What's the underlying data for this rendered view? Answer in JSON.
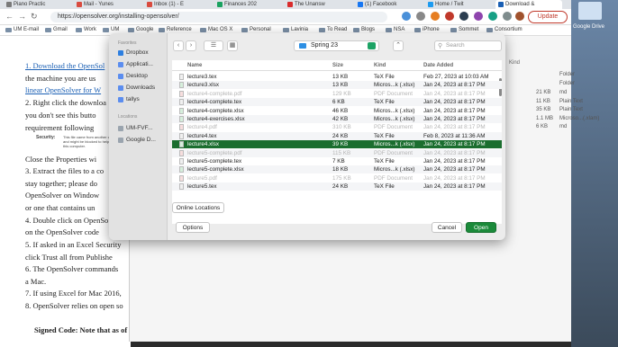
{
  "browser": {
    "tabs": [
      {
        "label": "Piano Practic",
        "color": "#7a7a7a"
      },
      {
        "label": "Mail - Yunes",
        "color": "#d94b3f"
      },
      {
        "label": "Inbox (1) - E",
        "color": "#d94b3f"
      },
      {
        "label": "Finances 202",
        "color": "#1aa260"
      },
      {
        "label": "The Unansw",
        "color": "#d92c2c"
      },
      {
        "label": "(1) Facebook",
        "color": "#1877f2"
      },
      {
        "label": "Home / Twit",
        "color": "#1d9bf0"
      },
      {
        "label": "Download &",
        "color": "#1a5fb4"
      }
    ],
    "url": "https://opensolver.org/installing-opensolver/",
    "update_label": "Update",
    "bookmarks": [
      "UM E-mail",
      "Gmail",
      "Work",
      "UM",
      "Google",
      "Reference",
      "Mac OS X",
      "Personal",
      "Lavinia",
      "To Read",
      "Blogs",
      "NSA",
      "iPhone",
      "Sommet",
      "Consortium"
    ]
  },
  "desktop": {
    "google_drive_label": "Google Drive"
  },
  "page": {
    "lines": [
      {
        "text": "1. Download the OpenSol",
        "style": "link"
      },
      {
        "text": "   the machine you are us",
        "style": "normal"
      },
      {
        "text": "   linear OpenSolver for W",
        "style": "link"
      },
      {
        "text": "2. Right click the downloa",
        "style": "normal"
      },
      {
        "text": "   you don't see this butto",
        "style": "normal"
      },
      {
        "text": "   requirement following",
        "style": "normal"
      },
      {
        "text": "   Close the Properties wi",
        "style": "normal"
      },
      {
        "text": "3. Extract the files to a co",
        "style": "normal"
      },
      {
        "text": "   stay together; please do",
        "style": "normal"
      },
      {
        "text": "   OpenSolver on Window",
        "style": "normal"
      },
      {
        "text": "   or one that contains un",
        "style": "normal"
      },
      {
        "text": "4. Double click on OpenSo",
        "style": "normal"
      },
      {
        "text": "   on the OpenSolver code",
        "style": "normal"
      },
      {
        "text": "5. If asked in an Excel Security",
        "style": "normal"
      },
      {
        "text": "   click Trust all from Publishe",
        "style": "normal"
      },
      {
        "text": "6. The OpenSolver commands",
        "style": "normal"
      },
      {
        "text": "   a Mac.",
        "style": "normal"
      },
      {
        "text": "7. If using Excel for Mac 2016,",
        "style": "normal"
      },
      {
        "text": "8. OpenSolver relies on open so",
        "style": "normal"
      },
      {
        "text": "Signed Code: Note that as of",
        "style": "bold"
      }
    ],
    "security_label": "Security:",
    "security_note": "This file came from another computer and might be blocked to help protect this computer."
  },
  "finder_behind": {
    "header": "Kind",
    "rows": [
      {
        "size": "",
        "kind": "Folder"
      },
      {
        "size": "",
        "kind": "Folder"
      },
      {
        "size": "21 KB",
        "kind": "md"
      },
      {
        "size": "11 KB",
        "kind": "Plain Text"
      },
      {
        "size": "35 KB",
        "kind": "Plain Text"
      },
      {
        "size": "1.1 MB",
        "kind": "Microso...(.xlam)"
      },
      {
        "size": "6 KB",
        "kind": "md"
      }
    ]
  },
  "dialog": {
    "sidebar": {
      "favorites_title": "Favorites",
      "favorites": [
        "Dropbox",
        "Applicati...",
        "Desktop",
        "Downloads",
        "tallys"
      ],
      "locations_title": "Locations",
      "locations": [
        "UM-FVF...",
        "Google D..."
      ]
    },
    "location": "Spring 23",
    "search_placeholder": "Search",
    "columns": {
      "name": "Name",
      "size": "Size",
      "kind": "Kind",
      "date": "Date Added"
    },
    "files": [
      {
        "name": "lecture3.tex",
        "size": "13 KB",
        "kind": "TeX File",
        "date": "Feb 27, 2023 at 10:03 AM",
        "dim": false
      },
      {
        "name": "lecture3.xlsx",
        "size": "13 KB",
        "kind": "Micros...k (.xlsx)",
        "date": "Jan 24, 2023 at 8:17 PM",
        "dim": false
      },
      {
        "name": "lecture4-complete.pdf",
        "size": "129 KB",
        "kind": "PDF Document",
        "date": "Jan 24, 2023 at 8:17 PM",
        "dim": true
      },
      {
        "name": "lecture4-complete.tex",
        "size": "6 KB",
        "kind": "TeX File",
        "date": "Jan 24, 2023 at 8:17 PM",
        "dim": false
      },
      {
        "name": "lecture4-complete.xlsx",
        "size": "46 KB",
        "kind": "Micros...k (.xlsx)",
        "date": "Jan 24, 2023 at 8:17 PM",
        "dim": false
      },
      {
        "name": "lecture4-exercises.xlsx",
        "size": "42 KB",
        "kind": "Micros...k (.xlsx)",
        "date": "Jan 24, 2023 at 8:17 PM",
        "dim": false
      },
      {
        "name": "lecture4.pdf",
        "size": "310 KB",
        "kind": "PDF Document",
        "date": "Jan 24, 2023 at 8:17 PM",
        "dim": true
      },
      {
        "name": "lecture4.tex",
        "size": "24 KB",
        "kind": "TeX File",
        "date": "Feb 8, 2023 at 11:36 AM",
        "dim": false
      },
      {
        "name": "lecture4.xlsx",
        "size": "39 KB",
        "kind": "Micros...k (.xlsx)",
        "date": "Jan 24, 2023 at 8:17 PM",
        "dim": false,
        "selected": true
      },
      {
        "name": "lecture5-complete.pdf",
        "size": "115 KB",
        "kind": "PDF Document",
        "date": "Jan 24, 2023 at 8:17 PM",
        "dim": true
      },
      {
        "name": "lecture5-complete.tex",
        "size": "7 KB",
        "kind": "TeX File",
        "date": "Jan 24, 2023 at 8:17 PM",
        "dim": false
      },
      {
        "name": "lecture5-complete.xlsx",
        "size": "18 KB",
        "kind": "Micros...k (.xlsx)",
        "date": "Jan 24, 2023 at 8:17 PM",
        "dim": false
      },
      {
        "name": "lecture5.pdf",
        "size": "175 KB",
        "kind": "PDF Document",
        "date": "Jan 24, 2023 at 8:17 PM",
        "dim": true
      },
      {
        "name": "lecture5.tex",
        "size": "24 KB",
        "kind": "TeX File",
        "date": "Jan 24, 2023 at 8:17 PM",
        "dim": false
      }
    ],
    "online_locations_label": "Online Locations",
    "options_label": "Options",
    "cancel_label": "Cancel",
    "open_label": "Open"
  }
}
